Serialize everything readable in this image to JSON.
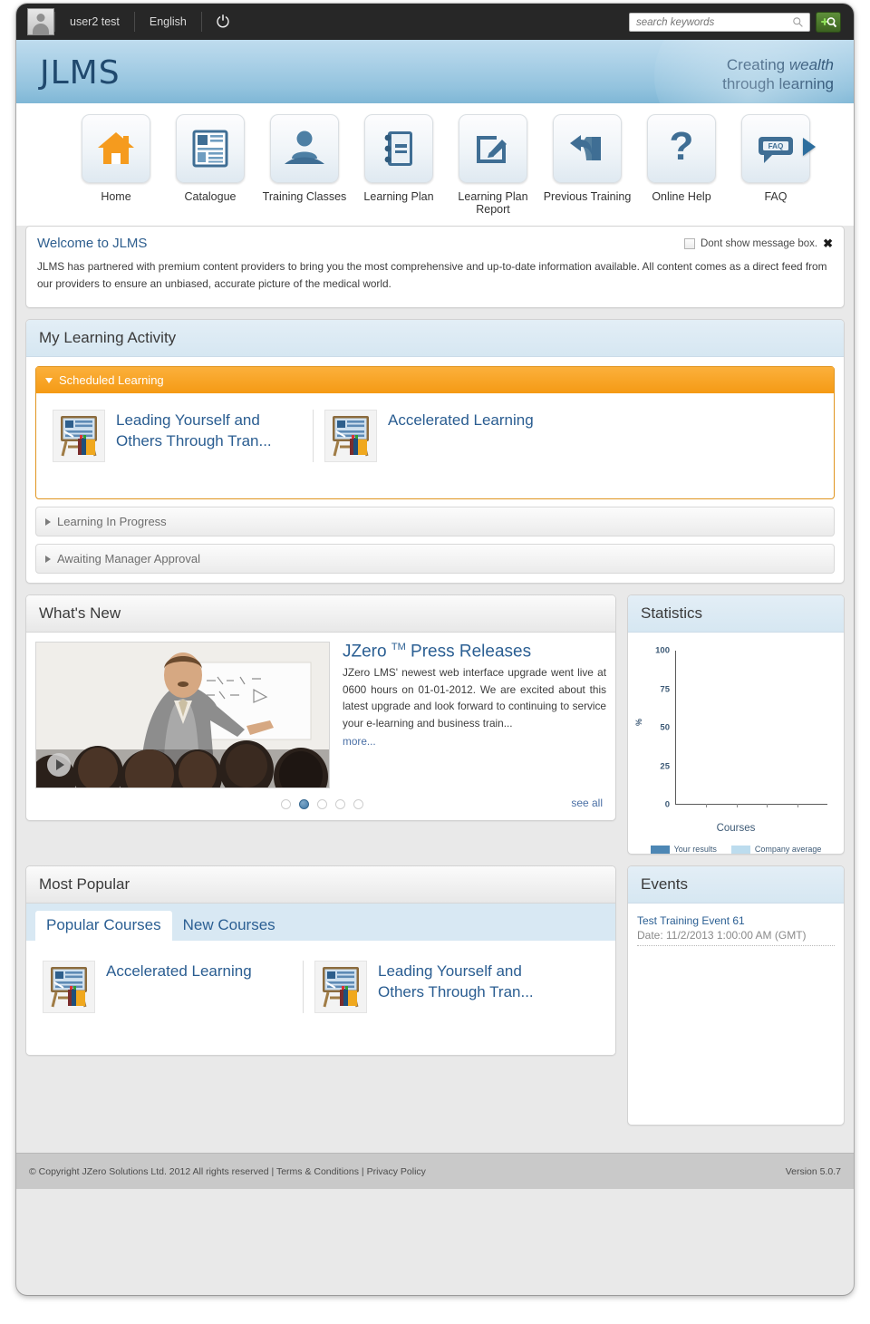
{
  "topbar": {
    "avatar_icon": "user-avatar-icon",
    "user_name": "user2 test",
    "language": "English",
    "power_icon": "power-off-icon",
    "search": {
      "placeholder": "search keywords",
      "value": "",
      "icon": "search-icon"
    },
    "advanced_search_icon": "advanced-search-icon"
  },
  "banner": {
    "logo": "JLMS",
    "tagline_line1_pre": "Creating ",
    "tagline_line1_em": "wealth",
    "tagline_line2": "through learning"
  },
  "nav": {
    "items": [
      {
        "label": "Home",
        "icon": "house-icon"
      },
      {
        "label": "Catalogue",
        "icon": "catalogue-page-icon"
      },
      {
        "label": "Training Classes",
        "icon": "person-podium-icon"
      },
      {
        "label": "Learning Plan",
        "icon": "notebook-icon"
      },
      {
        "label": "Learning Plan Report",
        "icon": "pencil-square-icon"
      },
      {
        "label": "Previous Training",
        "icon": "back-arrow-book-icon"
      },
      {
        "label": "Online Help",
        "icon": "question-mark-icon"
      },
      {
        "label": "FAQ",
        "icon": "faq-speech-bubble-icon"
      }
    ],
    "next_icon": "chevron-right-icon"
  },
  "message_box": {
    "title": "Welcome to JLMS",
    "checkbox_label": "Dont show message box.",
    "close_icon": "close-icon",
    "body": "JLMS has partnered with premium content providers to bring you the most comprehensive and up-to-date information available. All content comes as a direct feed from our providers to ensure an unbiased, accurate picture of the medical world."
  },
  "learning_activity": {
    "title": "My Learning Activity",
    "sections": [
      {
        "label": "Scheduled Learning",
        "state": "expanded",
        "caret_icon": "caret-down-icon"
      },
      {
        "label": "Learning In Progress",
        "state": "collapsed",
        "caret_icon": "caret-right-icon"
      },
      {
        "label": "Awaiting Manager Approval",
        "state": "collapsed",
        "caret_icon": "caret-right-icon"
      }
    ],
    "scheduled_courses": [
      {
        "title": "Leading Yourself and Others Through Tran...",
        "icon": "course-blackboard-icon"
      },
      {
        "title": "Accelerated Learning",
        "icon": "course-blackboard-icon"
      }
    ]
  },
  "whats_new": {
    "title": "What's New",
    "video": {
      "play_icon": "play-icon",
      "alt": "presenter-at-whiteboard-photo"
    },
    "article_title_main": "JZero",
    "article_title_tm": "TM",
    "article_title_rest": "Press Releases",
    "article_body": "JZero LMS' newest web interface upgrade went live at 0600 hours on 01-01-2012. We are excited about this latest upgrade and look forward to continuing to service your e-learning and business train...",
    "more_label": "more...",
    "see_all_label": "see all",
    "dot_count": 5,
    "active_dot": 2
  },
  "statistics": {
    "title": "Statistics",
    "chart_data": {
      "type": "bar",
      "title": "Statistics",
      "xlabel": "Courses",
      "ylabel": "%",
      "ylim": [
        0,
        100
      ],
      "yticks": [
        0,
        25,
        50,
        75,
        100
      ],
      "categories": [],
      "xtick_count": 4,
      "grid": false,
      "legend_position": "bottom",
      "series": [
        {
          "name": "Your results",
          "color": "#4d87b5",
          "values": []
        },
        {
          "name": "Company average",
          "color": "#bcdcee",
          "values": []
        }
      ],
      "note": "empty plot - axes only, no data bars rendered"
    }
  },
  "most_popular": {
    "title": "Most Popular",
    "tabs": [
      {
        "label": "Popular Courses",
        "active": true
      },
      {
        "label": "New Courses",
        "active": false
      }
    ],
    "courses": [
      {
        "title": "Accelerated Learning",
        "icon": "course-blackboard-icon"
      },
      {
        "title": "Leading Yourself and Others Through Tran...",
        "icon": "course-blackboard-icon"
      }
    ]
  },
  "events": {
    "title": "Events",
    "items": [
      {
        "title": "Test Training Event 61",
        "date": "Date: 11/2/2013 1:00:00 AM (GMT)"
      }
    ]
  },
  "footer": {
    "copyright": "© Copyright JZero Solutions Ltd. 2012 All rights reserved",
    "terms": "Terms & Conditions",
    "privacy": "Privacy Policy",
    "sep": "|",
    "version": "Version 5.0.7"
  },
  "colors": {
    "accent_blue": "#2b5f93",
    "banner_blue": "#a8cfe6",
    "accordion_orange": "#f59a14",
    "topbar_dark": "#272727",
    "page_grey": "#e9e9e9"
  }
}
